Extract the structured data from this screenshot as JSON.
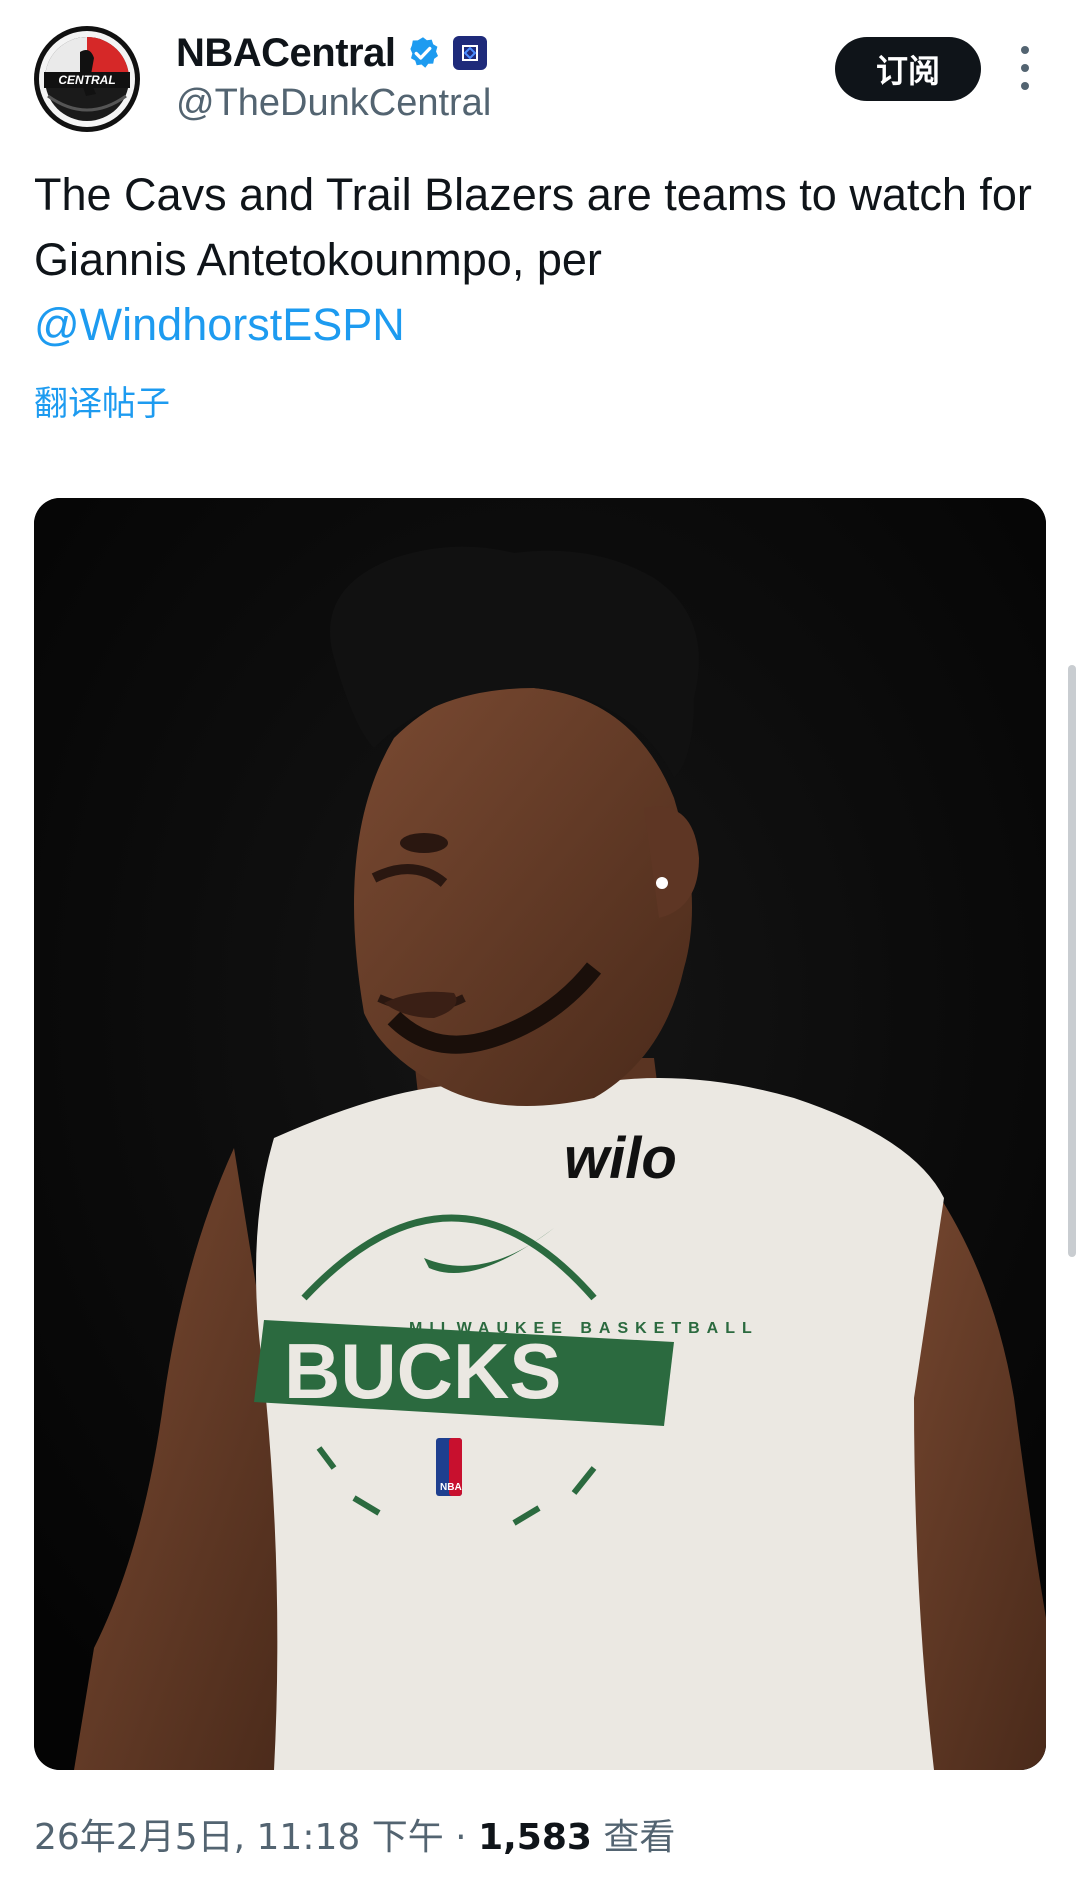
{
  "author": {
    "display_name": "NBACentral",
    "handle": "@TheDunkCentral",
    "avatar_text": "CENTRAL"
  },
  "actions": {
    "subscribe_label": "订阅"
  },
  "tweet": {
    "text": "The Cavs and Trail Blazers are teams to watch for Giannis Antetokounmpo, per",
    "mention": "@WindhorstESPN",
    "translate_label": "翻译帖子"
  },
  "media": {
    "jersey_brand": "wilo",
    "jersey_team": "BUCKS",
    "jersey_arc_text": "MILWAUKEE BASKETBALL",
    "jersey_logo_text": "NBA"
  },
  "meta": {
    "timestamp": "26年2月5日, 11:18 下午",
    "separator": "·",
    "views_count": "1,583",
    "views_label": "查看"
  },
  "colors": {
    "accent": "#1d9bf0",
    "text": "#0f1419",
    "secondary": "#536471",
    "bucks_green": "#2b6a3f"
  }
}
